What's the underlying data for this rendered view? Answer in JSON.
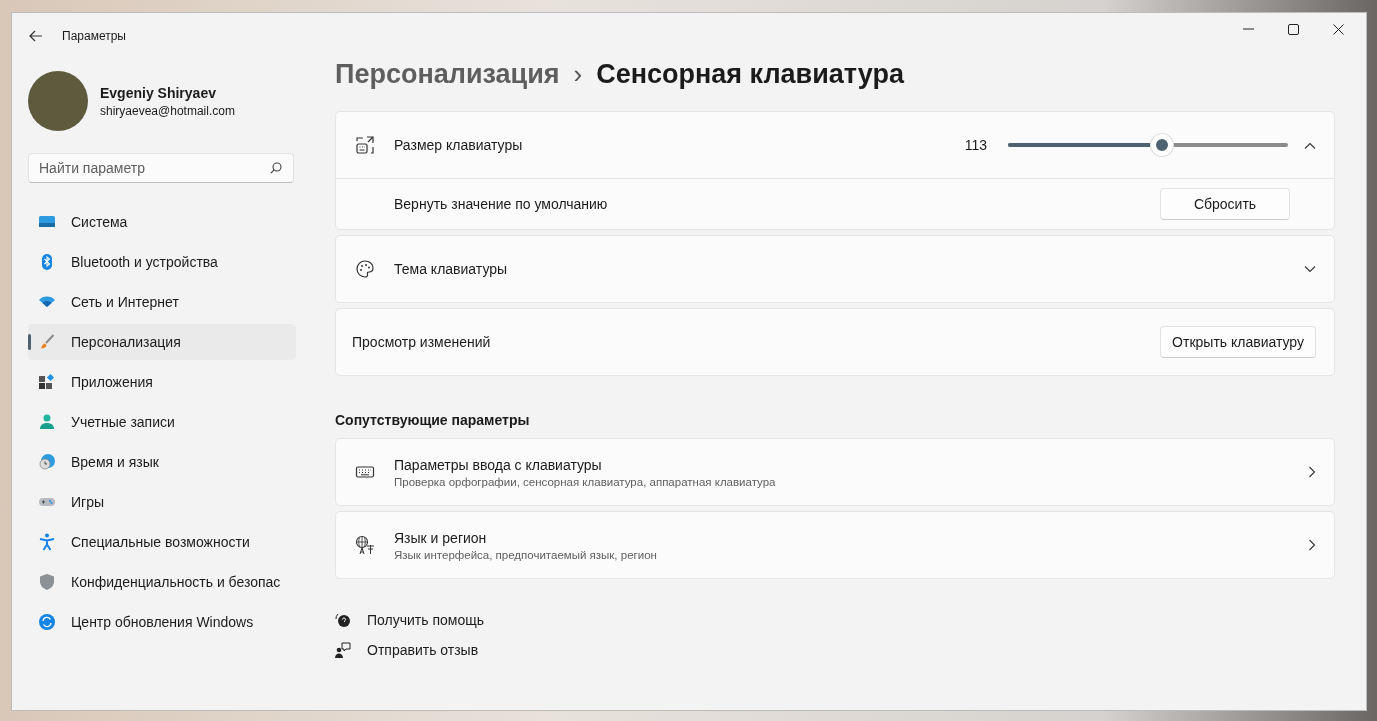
{
  "window": {
    "title": "Параметры"
  },
  "user": {
    "name": "Evgeniy Shiryaev",
    "email": "shiryaevea@hotmail.com"
  },
  "search": {
    "placeholder": "Найти параметр"
  },
  "sidebar": {
    "items": [
      {
        "label": "Система",
        "selected": false
      },
      {
        "label": "Bluetooth и устройства",
        "selected": false
      },
      {
        "label": "Сеть и Интернет",
        "selected": false
      },
      {
        "label": "Персонализация",
        "selected": true
      },
      {
        "label": "Приложения",
        "selected": false
      },
      {
        "label": "Учетные записи",
        "selected": false
      },
      {
        "label": "Время и язык",
        "selected": false
      },
      {
        "label": "Игры",
        "selected": false
      },
      {
        "label": "Специальные возможности",
        "selected": false
      },
      {
        "label": "Конфиденциальность и безопас",
        "selected": false
      },
      {
        "label": "Центр обновления Windows",
        "selected": false
      }
    ]
  },
  "breadcrumb": {
    "parent": "Персонализация",
    "separator": "›",
    "current": "Сенсорная клавиатура"
  },
  "size_card": {
    "label": "Размер клавиатуры",
    "reading": "113",
    "level": 0.51,
    "expanded": true,
    "reset_label": "Вернуть значение по умолчанию",
    "reset_button": "Сбросить"
  },
  "theme_card": {
    "label": "Тема клавиатуры",
    "expanded": false
  },
  "preview_card": {
    "label": "Просмотр изменений",
    "button": "Открыть клавиатуру"
  },
  "related": {
    "heading": "Сопутствующие параметры",
    "items": [
      {
        "title": "Параметры ввода с клавиатуры",
        "subtitle": "Проверка орфографии, сенсорная клавиатура, аппаратная клавиатура"
      },
      {
        "title": "Язык и регион",
        "subtitle": "Язык интерфейса, предпочитаемый язык, регион"
      }
    ]
  },
  "footer_links": [
    "Получить помощь",
    "Отправить отзыв"
  ]
}
